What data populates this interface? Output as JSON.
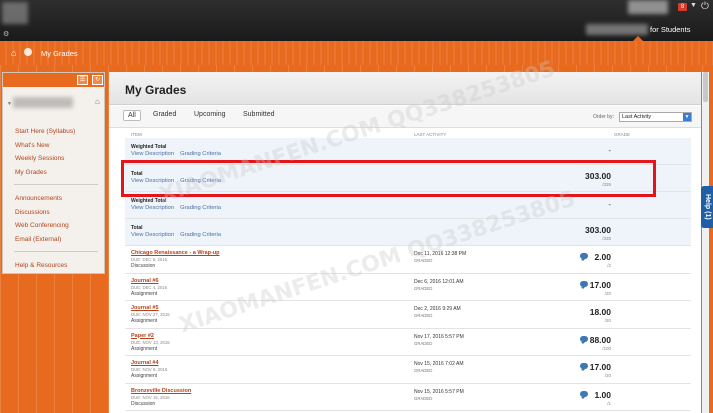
{
  "header": {
    "cs_icon": "⚙",
    "badge": "8",
    "role_label": "for Students"
  },
  "breadcrumb": {
    "home_icon": "home-icon",
    "current": "My Grades"
  },
  "sidebar": {
    "items": [
      {
        "label": "Start Here (Syllabus)"
      },
      {
        "label": "What's New"
      },
      {
        "label": "Weekly Sessions"
      },
      {
        "label": "My Grades"
      }
    ],
    "items2": [
      {
        "label": "Announcements"
      },
      {
        "label": "Discussions"
      },
      {
        "label": "Web Conferencing"
      },
      {
        "label": "Email (External)"
      }
    ],
    "items3": [
      {
        "label": "Help & Resources"
      }
    ]
  },
  "page": {
    "title": "My Grades"
  },
  "filters": {
    "tabs": [
      "All",
      "Graded",
      "Upcoming",
      "Submitted"
    ],
    "order_label": "Order by:",
    "order_value": "Last Activity"
  },
  "columns": {
    "item": "ITEM",
    "activity": "LAST ACTIVITY",
    "grade": "GRADE"
  },
  "totals": [
    {
      "name": "Weighted Total",
      "links": [
        "View Description",
        "Grading Criteria"
      ],
      "grade": "-",
      "out_of": ""
    },
    {
      "name": "Total",
      "links": [
        "View Description",
        "Grading Criteria"
      ],
      "grade": "303.00",
      "out_of": "/335"
    },
    {
      "name": "Weighted Total",
      "links": [
        "View Description",
        "Grading Criteria"
      ],
      "grade": "-",
      "out_of": ""
    },
    {
      "name": "Total",
      "links": [
        "View Description",
        "Grading Criteria"
      ],
      "grade": "303.00",
      "out_of": "/335"
    }
  ],
  "items": [
    {
      "name": "Chicago Renaissance - a Wrap-up",
      "due": "DUE: DEC 6, 2016",
      "type": "Discussion",
      "activity": "Dec 11, 2016 12:38 PM",
      "status": "GRADED",
      "grade": "2.00",
      "out_of": "/2",
      "comment": true
    },
    {
      "name": "Journal #6",
      "due": "DUE: DEC 4, 2016",
      "type": "Assignment",
      "activity": "Dec 6, 2016 12:01 AM",
      "status": "GRADED",
      "grade": "17.00",
      "out_of": "/20",
      "comment": true
    },
    {
      "name": "Journal #5",
      "due": "DUE: NOV 27, 2016",
      "type": "Assignment",
      "activity": "Dec 2, 2016 9:29 AM",
      "status": "GRADED",
      "grade": "18.00",
      "out_of": "/20",
      "comment": false
    },
    {
      "name": "Paper #2",
      "due": "DUE: NOV 13, 2016",
      "type": "Assignment",
      "activity": "Nov 17, 2016 5:57 PM",
      "status": "GRADED",
      "grade": "88.00",
      "out_of": "/100",
      "comment": true
    },
    {
      "name": "Journal #4",
      "due": "DUE: NOV 6, 2016",
      "type": "Assignment",
      "activity": "Nov 15, 2016 7:02 AM",
      "status": "GRADED",
      "grade": "17.00",
      "out_of": "/20",
      "comment": true
    },
    {
      "name": "Bronzeville Discussion",
      "due": "DUE: NOV 15, 2016",
      "type": "Discussion",
      "activity": "Nov 15, 2016 5:57 PM",
      "status": "GRADED",
      "grade": "1.00",
      "out_of": "/1",
      "comment": true
    }
  ],
  "help": {
    "label": "Help (1)"
  },
  "watermark": {
    "text": "XIAOMANFEN.COM QQ338253805"
  }
}
